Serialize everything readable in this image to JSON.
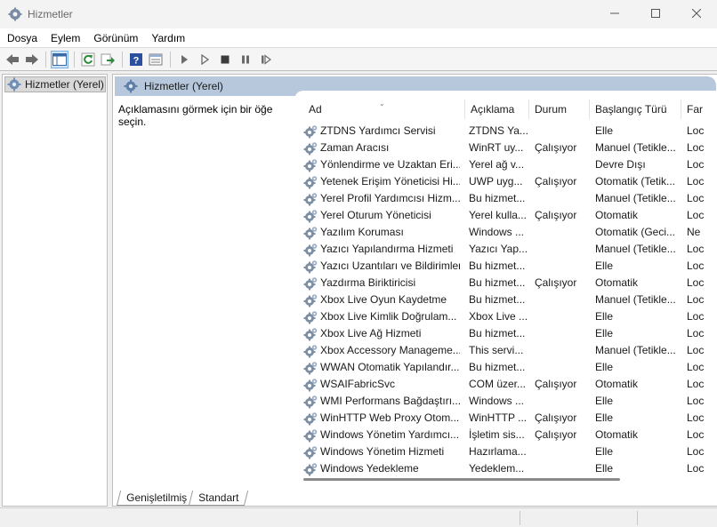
{
  "window": {
    "title": "Hizmetler"
  },
  "menu": [
    "Dosya",
    "Eylem",
    "Görünüm",
    "Yardım"
  ],
  "toolbar": {
    "icons": [
      "back-icon",
      "forward-icon",
      "show-hide-tree-icon",
      "refresh-icon",
      "export-list-icon",
      "help-icon",
      "properties-icon",
      "start-service-icon",
      "start-service-alt-icon",
      "stop-service-icon",
      "pause-service-icon",
      "resume-service-icon"
    ]
  },
  "tree": {
    "item": "Hizmetler (Yerel)"
  },
  "pane": {
    "header": "Hizmetler (Yerel)",
    "description": "Açıklamasını görmek için bir öğe seçin."
  },
  "columns": [
    "Ad",
    "Açıklama",
    "Durum",
    "Başlangıç Türü",
    "Far"
  ],
  "services": [
    {
      "name": "ZTDNS Yardımcı Servisi",
      "desc": "ZTDNS Ya...",
      "status": "",
      "start": "Elle",
      "logon": "Loc"
    },
    {
      "name": "Zaman Aracısı",
      "desc": "WinRT uy...",
      "status": "Çalışıyor",
      "start": "Manuel (Tetikle...",
      "logon": "Loc"
    },
    {
      "name": "Yönlendirme ve Uzaktan Eri...",
      "desc": "Yerel ağ v...",
      "status": "",
      "start": "Devre Dışı",
      "logon": "Loc"
    },
    {
      "name": "Yetenek Erişim Yöneticisi Hi...",
      "desc": "UWP uyg...",
      "status": "Çalışıyor",
      "start": "Otomatik (Tetik...",
      "logon": "Loc"
    },
    {
      "name": "Yerel Profil Yardımcısı Hizm...",
      "desc": "Bu hizmet...",
      "status": "",
      "start": "Manuel (Tetikle...",
      "logon": "Loc"
    },
    {
      "name": "Yerel Oturum Yöneticisi",
      "desc": "Yerel kulla...",
      "status": "Çalışıyor",
      "start": "Otomatik",
      "logon": "Loc"
    },
    {
      "name": "Yazılım Koruması",
      "desc": "Windows ...",
      "status": "",
      "start": "Otomatik (Geci...",
      "logon": "Ne"
    },
    {
      "name": "Yazıcı Yapılandırma Hizmeti",
      "desc": "Yazıcı Yap...",
      "status": "",
      "start": "Manuel (Tetikle...",
      "logon": "Loc"
    },
    {
      "name": "Yazıcı Uzantıları ve Bildirimleri",
      "desc": "Bu hizmet...",
      "status": "",
      "start": "Elle",
      "logon": "Loc"
    },
    {
      "name": "Yazdırma Biriktiricisi",
      "desc": "Bu hizmet...",
      "status": "Çalışıyor",
      "start": "Otomatik",
      "logon": "Loc"
    },
    {
      "name": "Xbox Live Oyun Kaydetme",
      "desc": "Bu hizmet...",
      "status": "",
      "start": "Manuel (Tetikle...",
      "logon": "Loc"
    },
    {
      "name": "Xbox Live Kimlik Doğrulam...",
      "desc": "Xbox Live ...",
      "status": "",
      "start": "Elle",
      "logon": "Loc"
    },
    {
      "name": "Xbox Live Ağ Hizmeti",
      "desc": "Bu hizmet...",
      "status": "",
      "start": "Elle",
      "logon": "Loc"
    },
    {
      "name": "Xbox Accessory Manageme...",
      "desc": "This servi...",
      "status": "",
      "start": "Manuel (Tetikle...",
      "logon": "Loc"
    },
    {
      "name": "WWAN Otomatik Yapılandır...",
      "desc": "Bu hizmet...",
      "status": "",
      "start": "Elle",
      "logon": "Loc"
    },
    {
      "name": "WSAIFabricSvc",
      "desc": "COM üzer...",
      "status": "Çalışıyor",
      "start": "Otomatik",
      "logon": "Loc"
    },
    {
      "name": "WMI Performans Bağdaştırı...",
      "desc": "Windows ...",
      "status": "",
      "start": "Elle",
      "logon": "Loc"
    },
    {
      "name": "WinHTTP Web Proxy Otom...",
      "desc": "WinHTTP ...",
      "status": "Çalışıyor",
      "start": "Elle",
      "logon": "Loc"
    },
    {
      "name": "Windows Yönetim Yardımcı...",
      "desc": "İşletim sis...",
      "status": "Çalışıyor",
      "start": "Otomatik",
      "logon": "Loc"
    },
    {
      "name": "Windows Yönetim Hizmeti",
      "desc": "Hazırlama...",
      "status": "",
      "start": "Elle",
      "logon": "Loc"
    },
    {
      "name": "Windows Yedekleme",
      "desc": "Yedeklem...",
      "status": "",
      "start": "Elle",
      "logon": "Loc"
    }
  ],
  "tabs": [
    "Genişletilmiş",
    "Standart"
  ]
}
